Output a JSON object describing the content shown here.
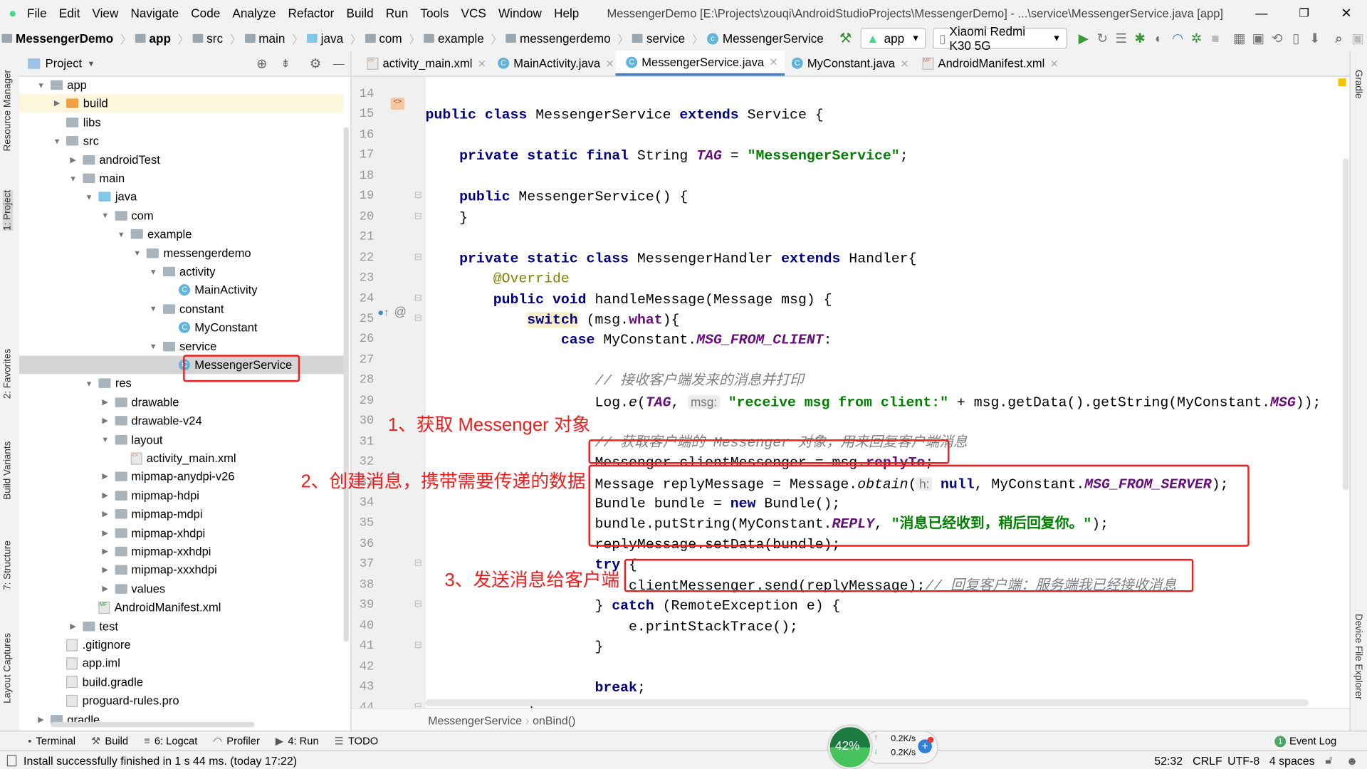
{
  "title_bar": {
    "menu": [
      "File",
      "Edit",
      "View",
      "Navigate",
      "Code",
      "Analyze",
      "Refactor",
      "Build",
      "Run",
      "Tools",
      "VCS",
      "Window",
      "Help"
    ],
    "window_title": "MessengerDemo [E:\\Projects\\zouqi\\AndroidStudioProjects\\MessengerDemo] - ...\\service\\MessengerService.java [app]"
  },
  "nav_bar": {
    "breadcrumbs": [
      "MessengerDemo",
      "app",
      "src",
      "main",
      "java",
      "com",
      "example",
      "messengerdemo",
      "service",
      "MessengerService"
    ],
    "run_config": "app",
    "device": "Xiaomi Redmi K30 5G"
  },
  "left_strip": [
    "Resource Manager",
    "1: Project",
    "2: Favorites",
    "Build Variants",
    "7: Structure",
    "Layout Captures"
  ],
  "right_strip": [
    "Gradle",
    "Device File Explorer"
  ],
  "project_panel": {
    "title": "Project",
    "tree": [
      {
        "label": "app",
        "level": 0,
        "type": "folder",
        "expanded": true
      },
      {
        "label": "build",
        "level": 1,
        "type": "folder-orange",
        "expanded": false
      },
      {
        "label": "libs",
        "level": 1,
        "type": "folder",
        "leaf": true
      },
      {
        "label": "src",
        "level": 1,
        "type": "folder",
        "expanded": true
      },
      {
        "label": "androidTest",
        "level": 2,
        "type": "folder",
        "expanded": false
      },
      {
        "label": "main",
        "level": 2,
        "type": "folder",
        "expanded": true
      },
      {
        "label": "java",
        "level": 3,
        "type": "folder-blue",
        "expanded": true
      },
      {
        "label": "com",
        "level": 4,
        "type": "folder",
        "expanded": true
      },
      {
        "label": "example",
        "level": 5,
        "type": "folder",
        "expanded": true
      },
      {
        "label": "messengerdemo",
        "level": 6,
        "type": "folder",
        "expanded": true
      },
      {
        "label": "activity",
        "level": 7,
        "type": "folder",
        "expanded": true
      },
      {
        "label": "MainActivity",
        "level": 8,
        "type": "class",
        "leaf": true
      },
      {
        "label": "constant",
        "level": 7,
        "type": "folder",
        "expanded": true
      },
      {
        "label": "MyConstant",
        "level": 8,
        "type": "class",
        "leaf": true
      },
      {
        "label": "service",
        "level": 7,
        "type": "folder",
        "expanded": true
      },
      {
        "label": "MessengerService",
        "level": 8,
        "type": "class",
        "leaf": true,
        "selected": true
      },
      {
        "label": "res",
        "level": 3,
        "type": "folder",
        "expanded": true
      },
      {
        "label": "drawable",
        "level": 4,
        "type": "folder",
        "expanded": false
      },
      {
        "label": "drawable-v24",
        "level": 4,
        "type": "folder",
        "expanded": false
      },
      {
        "label": "layout",
        "level": 4,
        "type": "folder",
        "expanded": true
      },
      {
        "label": "activity_main.xml",
        "level": 5,
        "type": "xml",
        "leaf": true
      },
      {
        "label": "mipmap-anydpi-v26",
        "level": 4,
        "type": "folder",
        "expanded": false
      },
      {
        "label": "mipmap-hdpi",
        "level": 4,
        "type": "folder",
        "expanded": false
      },
      {
        "label": "mipmap-mdpi",
        "level": 4,
        "type": "folder",
        "expanded": false
      },
      {
        "label": "mipmap-xhdpi",
        "level": 4,
        "type": "folder",
        "expanded": false
      },
      {
        "label": "mipmap-xxhdpi",
        "level": 4,
        "type": "folder",
        "expanded": false
      },
      {
        "label": "mipmap-xxxhdpi",
        "level": 4,
        "type": "folder",
        "expanded": false
      },
      {
        "label": "values",
        "level": 4,
        "type": "folder",
        "expanded": false
      },
      {
        "label": "AndroidManifest.xml",
        "level": 3,
        "type": "manifest",
        "leaf": true
      },
      {
        "label": "test",
        "level": 2,
        "type": "folder",
        "expanded": false
      },
      {
        "label": ".gitignore",
        "level": 1,
        "type": "file",
        "leaf": true
      },
      {
        "label": "app.iml",
        "level": 1,
        "type": "file",
        "leaf": true
      },
      {
        "label": "build.gradle",
        "level": 1,
        "type": "file",
        "leaf": true
      },
      {
        "label": "proguard-rules.pro",
        "level": 1,
        "type": "file",
        "leaf": true
      },
      {
        "label": "gradle",
        "level": 0,
        "type": "folder",
        "expanded": false
      }
    ]
  },
  "editor": {
    "tabs": [
      {
        "label": "activity_main.xml",
        "active": false
      },
      {
        "label": "MainActivity.java",
        "active": false
      },
      {
        "label": "MessengerService.java",
        "active": true
      },
      {
        "label": "MyConstant.java",
        "active": false
      },
      {
        "label": "AndroidManifest.xml",
        "active": false
      }
    ],
    "first_line_number": 14,
    "lines": [
      [],
      [
        [
          "public class ",
          "kw"
        ],
        [
          "MessengerService ",
          ""
        ],
        [
          "extends ",
          "kw"
        ],
        [
          "Service {",
          ""
        ]
      ],
      [],
      [
        [
          "    private static final ",
          "kw"
        ],
        [
          "String ",
          ""
        ],
        [
          "TAG",
          "cst"
        ],
        [
          " = ",
          ""
        ],
        [
          "\"MessengerService\"",
          "str"
        ],
        [
          ";",
          ""
        ]
      ],
      [],
      [
        [
          "    public ",
          "kw"
        ],
        [
          "MessengerService() {",
          ""
        ]
      ],
      [
        [
          "    }",
          ""
        ]
      ],
      [],
      [
        [
          "    private static class ",
          "kw"
        ],
        [
          "MessengerHandler ",
          ""
        ],
        [
          "extends ",
          "kw"
        ],
        [
          "Handler{",
          ""
        ]
      ],
      [
        [
          "        @Override",
          "ann"
        ]
      ],
      [
        [
          "        public void ",
          "kw"
        ],
        [
          "handleMessage(Message msg) {",
          ""
        ]
      ],
      [
        [
          "            ",
          ""
        ],
        [
          "switch",
          "kw hl"
        ],
        [
          " (msg.",
          ""
        ],
        [
          "what",
          "fld"
        ],
        [
          "){",
          ""
        ]
      ],
      [
        [
          "                case ",
          "kw"
        ],
        [
          "MyConstant.",
          ""
        ],
        [
          "MSG_FROM_CLIENT",
          "cst"
        ],
        [
          ":",
          ""
        ]
      ],
      [],
      [
        [
          "                    // 接收客户端发来的消息并打印",
          "cmt"
        ]
      ],
      [
        [
          "                    Log.",
          ""
        ],
        [
          "e",
          "it"
        ],
        [
          "(",
          ""
        ],
        [
          "TAG",
          "cst"
        ],
        [
          ", ",
          ""
        ],
        [
          "msg:",
          "hint"
        ],
        [
          " ",
          ""
        ],
        [
          "\"receive msg from client:\"",
          "str"
        ],
        [
          " + msg.getData().getString(MyConstant.",
          ""
        ],
        [
          "MSG",
          "cst"
        ],
        [
          "));",
          ""
        ]
      ],
      [],
      [
        [
          "                    // 获取客户端的 Messenger 对象，用来回复客户端消息",
          "cmt"
        ]
      ],
      [
        [
          "                    Messenger clientMessenger = msg.",
          ""
        ],
        [
          "replyTo",
          "fld"
        ],
        [
          ";",
          ""
        ]
      ],
      [
        [
          "                    Message replyMessage = Message.",
          ""
        ],
        [
          "obtain",
          "it"
        ],
        [
          "(",
          ""
        ],
        [
          "h:",
          "hint"
        ],
        [
          " ",
          ""
        ],
        [
          "null",
          "kw"
        ],
        [
          ", MyConstant.",
          ""
        ],
        [
          "MSG_FROM_SERVER",
          "cst"
        ],
        [
          ");",
          ""
        ]
      ],
      [
        [
          "                    Bundle bundle = ",
          ""
        ],
        [
          "new ",
          "kw"
        ],
        [
          "Bundle();",
          ""
        ]
      ],
      [
        [
          "                    bundle.putString(MyConstant.",
          ""
        ],
        [
          "REPLY",
          "cst"
        ],
        [
          ", ",
          ""
        ],
        [
          "\"消息已经收到，稍后回复你。\"",
          "str"
        ],
        [
          ");",
          ""
        ]
      ],
      [
        [
          "                    replyMessage.setData(bundle);",
          ""
        ]
      ],
      [
        [
          "                    ",
          ""
        ],
        [
          "try ",
          "kw"
        ],
        [
          "{",
          ""
        ]
      ],
      [
        [
          "                        clientMessenger.send(replyMessage);",
          ""
        ],
        [
          "// 回复客户端：服务端我已经接收消息",
          "cmt"
        ]
      ],
      [
        [
          "                    } ",
          ""
        ],
        [
          "catch ",
          "kw"
        ],
        [
          "(RemoteException e) {",
          ""
        ]
      ],
      [
        [
          "                        e.printStackTrace();",
          ""
        ]
      ],
      [
        [
          "                    }",
          ""
        ]
      ],
      [],
      [
        [
          "                    ",
          ""
        ],
        [
          "break",
          "kw"
        ],
        [
          ";",
          ""
        ]
      ],
      [
        [
          "            }",
          ""
        ]
      ]
    ],
    "breadcrumb": [
      "MessengerService",
      "onBind()"
    ]
  },
  "annotations": {
    "step1": "1、获取 Messenger 对象",
    "step2": "2、创建消息，携带需要传递的数据",
    "step3": "3、发送消息给客户端",
    "color": "#f21c1c"
  },
  "tool_windows": [
    "Terminal",
    "Build",
    "6: Logcat",
    "Profiler",
    "4: Run",
    "TODO"
  ],
  "event_log": {
    "count": "1",
    "label": "Event Log"
  },
  "network_widget": {
    "percent": "42%",
    "up": "0.2K/s",
    "down": "0.2K/s"
  },
  "status_bar": {
    "message": "Install successfully finished in 1 s 44 ms. (today 17:22)",
    "position": "52:32",
    "line_sep": "CRLF",
    "encoding": "UTF-8",
    "indent": "4 spaces"
  }
}
